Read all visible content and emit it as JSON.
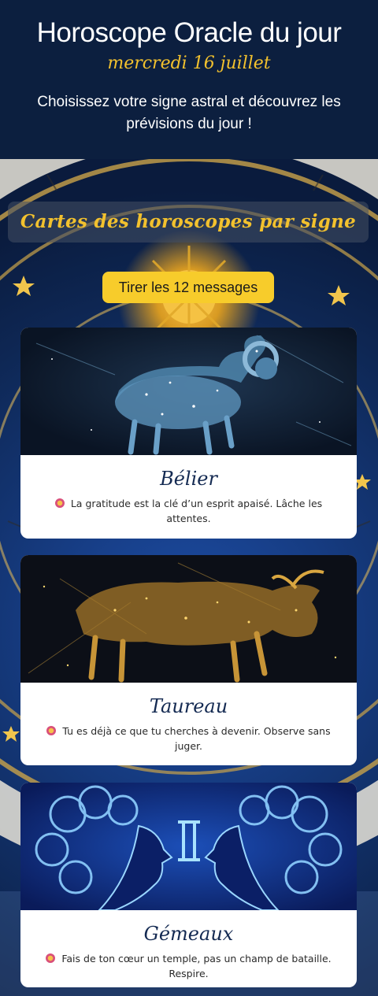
{
  "header": {
    "title": "Horoscope Oracle du jour",
    "date": "mercredi 16 juillet",
    "intro": "Choisissez votre signe astral et découvrez les prévisions du jour !"
  },
  "section": {
    "title": "Cartes des horoscopes par signe",
    "draw_button": "Tirer les 12 messages"
  },
  "cards": [
    {
      "sign": "Bélier",
      "icon": "ram-constellation-image",
      "message": "La gratitude est la clé d’un esprit apaisé. Lâche les attentes."
    },
    {
      "sign": "Taureau",
      "icon": "bull-constellation-image",
      "message": "Tu es déjà ce que tu cherches à devenir. Observe sans juger."
    },
    {
      "sign": "Gémeaux",
      "icon": "twins-image",
      "message": "Fais de ton cœur un temple, pas un champ de bataille. Respire."
    }
  ],
  "colors": {
    "header_bg": "#0c1f3f",
    "accent_gold": "#f2c12e",
    "button_yellow": "#f7cc2b",
    "card_title": "#142a52"
  }
}
